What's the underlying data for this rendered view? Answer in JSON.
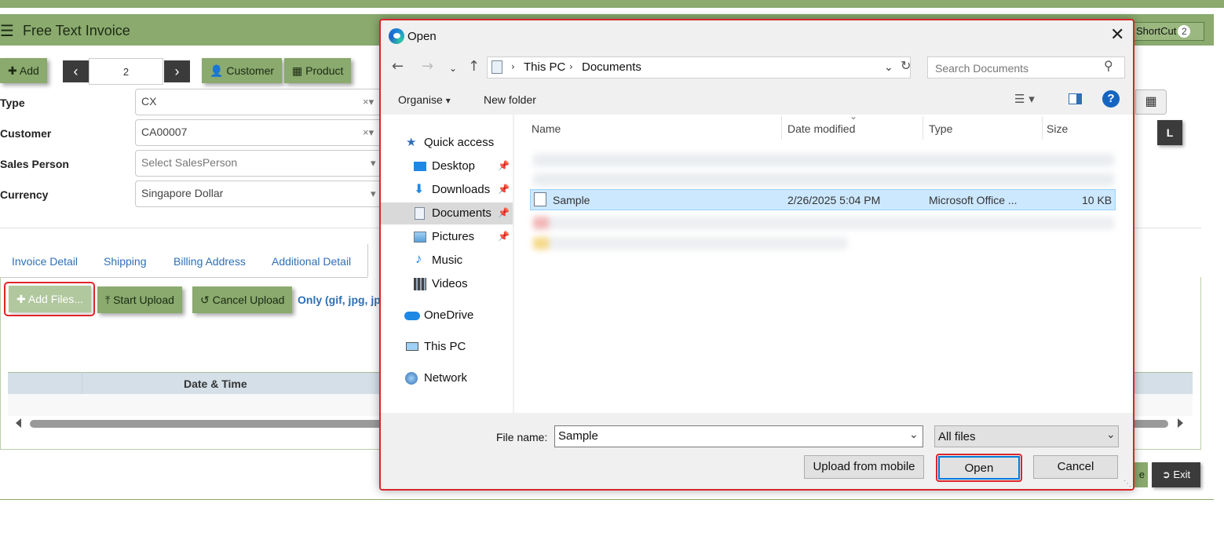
{
  "app": {
    "title": "Free Text Invoice",
    "shortcut_label": "ShortCut",
    "shortcut_count": "2",
    "toolbar": {
      "add_label": "Add",
      "pager_value": "2",
      "customer_label": "Customer",
      "product_label": "Product"
    },
    "form": {
      "type_label": "Type",
      "type_value": "CX",
      "customer_label": "Customer",
      "customer_value": "CA00007",
      "salesperson_label": "Sales Person",
      "salesperson_placeholder": "Select SalesPerson",
      "currency_label": "Currency",
      "currency_value": "Singapore Dollar"
    },
    "tabs": [
      "Invoice Detail",
      "Shipping",
      "Billing Address",
      "Additional Detail"
    ],
    "upload": {
      "add_files": "Add Files...",
      "start_upload": "Start Upload",
      "cancel_upload": "Cancel Upload",
      "only_text": "Only (gif, jpg, jp"
    },
    "grid": {
      "col_datetime": "Date & Time"
    },
    "footer": {
      "exit_label": "Exit",
      "save_partial": "e"
    },
    "right_l": "L",
    "accent": "#8aaa6e"
  },
  "dialog": {
    "title": "Open",
    "breadcrumb": [
      "This PC",
      "Documents"
    ],
    "search_placeholder": "Search Documents",
    "organise_label": "Organise",
    "new_folder_label": "New folder",
    "nav": [
      {
        "label": "Quick access",
        "icon": "star-icon"
      },
      {
        "label": "Desktop",
        "icon": "desktop-icon",
        "pinned": true
      },
      {
        "label": "Downloads",
        "icon": "download-icon",
        "pinned": true
      },
      {
        "label": "Documents",
        "icon": "documents-icon",
        "pinned": true
      },
      {
        "label": "Pictures",
        "icon": "pictures-icon",
        "pinned": true
      },
      {
        "label": "Music",
        "icon": "music-icon"
      },
      {
        "label": "Videos",
        "icon": "videos-icon"
      },
      {
        "label": "OneDrive",
        "icon": "cloud-icon"
      },
      {
        "label": "This PC",
        "icon": "computer-icon"
      },
      {
        "label": "Network",
        "icon": "network-icon"
      }
    ],
    "columns": [
      "Name",
      "Date modified",
      "Type",
      "Size"
    ],
    "selected_file": {
      "name": "Sample",
      "date": "2/26/2025 5:04 PM",
      "type": "Microsoft Office ...",
      "size": "10 KB"
    },
    "file_name_label": "File name:",
    "file_name_value": "Sample",
    "file_type_value": "All files",
    "upload_mobile_label": "Upload from mobile",
    "open_label": "Open",
    "cancel_label": "Cancel",
    "highlight_color": "#d9262b"
  }
}
